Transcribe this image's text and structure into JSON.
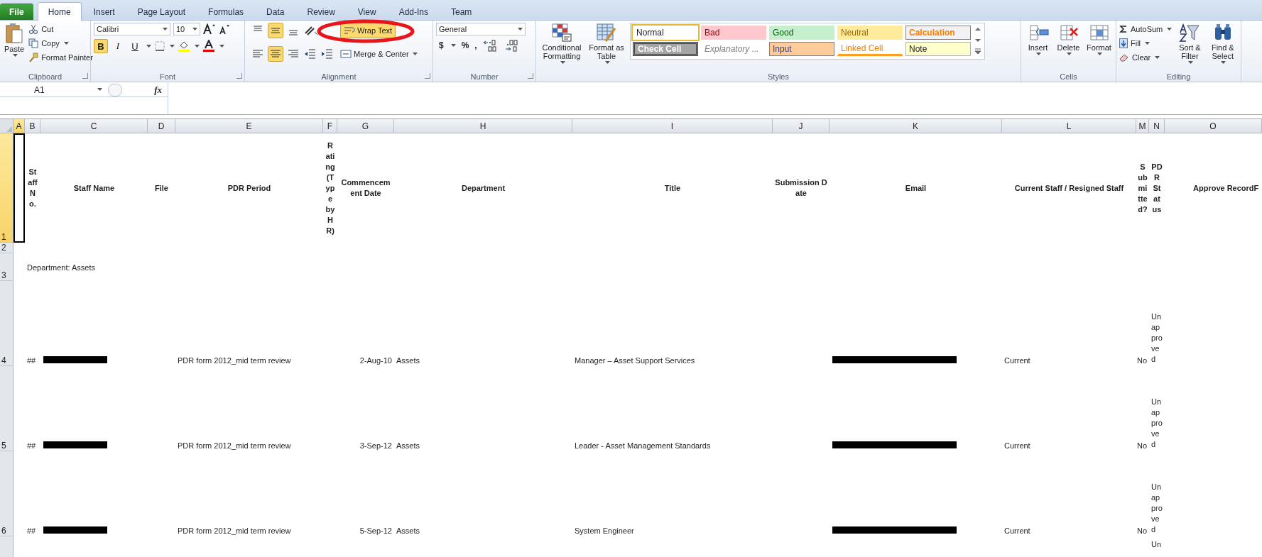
{
  "menu_tabs": [
    {
      "label": "File",
      "kind": "file",
      "selected": false
    },
    {
      "label": "Home",
      "kind": "tab",
      "selected": true
    },
    {
      "label": "Insert",
      "kind": "tab",
      "selected": false
    },
    {
      "label": "Page Layout",
      "kind": "tab",
      "selected": false
    },
    {
      "label": "Formulas",
      "kind": "tab",
      "selected": false
    },
    {
      "label": "Data",
      "kind": "tab",
      "selected": false
    },
    {
      "label": "Review",
      "kind": "tab",
      "selected": false
    },
    {
      "label": "View",
      "kind": "tab",
      "selected": false
    },
    {
      "label": "Add-Ins",
      "kind": "tab",
      "selected": false
    },
    {
      "label": "Team",
      "kind": "tab",
      "selected": false
    }
  ],
  "ribbon": {
    "clipboard": {
      "title": "Clipboard",
      "paste": "Paste",
      "cut": "Cut",
      "copy": "Copy",
      "format_painter": "Format Painter"
    },
    "font": {
      "title": "Font",
      "font_name": "Calibri",
      "font_size": "10",
      "bold": "B",
      "italic": "I",
      "underline": "U",
      "bold_selected": true
    },
    "alignment": {
      "title": "Alignment",
      "wrap_text": "Wrap Text",
      "wrap_text_selected": true,
      "wrap_text_circled": true,
      "merge": "Merge & Center",
      "middle_align_selected": true,
      "center_selected": true
    },
    "number": {
      "title": "Number",
      "format": "General",
      "currency": "$",
      "percent": "%",
      "comma": ","
    },
    "styles": {
      "title": "Styles",
      "conditional": "Conditional Formatting",
      "format_table": "Format as Table",
      "gallery": [
        {
          "label": "Normal",
          "kind": "normal",
          "selected": true
        },
        {
          "label": "Bad",
          "kind": "bad",
          "selected": false
        },
        {
          "label": "Good",
          "kind": "good",
          "selected": false
        },
        {
          "label": "Neutral",
          "kind": "neutral",
          "selected": false
        },
        {
          "label": "Calculation",
          "kind": "calculation",
          "selected": false
        },
        {
          "label": "Check Cell",
          "kind": "check",
          "selected": false
        },
        {
          "label": "Explanatory ...",
          "kind": "explanatory",
          "selected": false
        },
        {
          "label": "Input",
          "kind": "input",
          "selected": false
        },
        {
          "label": "Linked Cell",
          "kind": "linked",
          "selected": false
        },
        {
          "label": "Note",
          "kind": "note",
          "selected": false
        }
      ]
    },
    "cells": {
      "title": "Cells",
      "insert": "Insert",
      "delete": "Delete",
      "format": "Format"
    },
    "editing": {
      "title": "Editing",
      "autosum": "AutoSum",
      "fill": "Fill",
      "clear": "Clear",
      "sort": "Sort & Filter",
      "find": "Find & Select"
    }
  },
  "formula_bar": {
    "name_box": "A1",
    "fx": "fx"
  },
  "sheet": {
    "columns": [
      {
        "label": "A",
        "selected": true
      },
      {
        "label": "B",
        "selected": false
      },
      {
        "label": "C",
        "selected": false
      },
      {
        "label": "D",
        "selected": false
      },
      {
        "label": "E",
        "selected": false
      },
      {
        "label": "F",
        "selected": false
      },
      {
        "label": "G",
        "selected": false
      },
      {
        "label": "H",
        "selected": false
      },
      {
        "label": "I",
        "selected": false
      },
      {
        "label": "J",
        "selected": false
      },
      {
        "label": "K",
        "selected": false
      },
      {
        "label": "L",
        "selected": false
      },
      {
        "label": "M",
        "selected": false
      },
      {
        "label": "N",
        "selected": false
      },
      {
        "label": "O",
        "selected": false
      }
    ],
    "rows": [
      {
        "label": "1",
        "selected": true,
        "kind": "header",
        "cells": {
          "B": "Staff No.",
          "C": "Staff Name",
          "D": "File",
          "E": "PDR Period",
          "F": "Rating(Type by HR)",
          "G": "Commencement Date",
          "H": "Department",
          "I": "Title",
          "J": "Submission Date",
          "K": "Email",
          "L": "Current Staff / Resigned Staff",
          "M": "Submitted?",
          "N": "PDR Status",
          "O": "Approve RecordF"
        }
      },
      {
        "label": "2",
        "selected": false,
        "kind": "blank",
        "cells": {}
      },
      {
        "label": "3",
        "selected": false,
        "kind": "group",
        "cells": {
          "B": "Department: Assets"
        }
      },
      {
        "label": "4",
        "selected": false,
        "kind": "data",
        "name_redacted": true,
        "email_redacted": true,
        "cells": {
          "B": "##",
          "E": "PDR form 2012_mid term review",
          "G": "2-Aug-10",
          "H": "Assets",
          "I": "Manager – Asset Support Services",
          "L": "Current",
          "M": "No",
          "N": "Unapproved"
        }
      },
      {
        "label": "5",
        "selected": false,
        "kind": "data",
        "name_redacted": true,
        "email_redacted": true,
        "cells": {
          "B": "##",
          "E": "PDR form 2012_mid term review",
          "G": "3-Sep-12",
          "H": "Assets",
          "I": "Leader - Asset Management Standards",
          "L": "Current",
          "M": "No",
          "N": "Unapproved"
        }
      },
      {
        "label": "6",
        "selected": false,
        "kind": "data",
        "name_redacted": true,
        "email_redacted": true,
        "cells": {
          "B": "##",
          "E": "PDR form 2012_mid term review",
          "G": "5-Sep-12",
          "H": "Assets",
          "I": "System Engineer",
          "L": "Current",
          "M": "No",
          "N": "Unapproved"
        }
      },
      {
        "kind": "partial",
        "selected": false,
        "cells": {
          "N": "Un"
        }
      }
    ]
  }
}
